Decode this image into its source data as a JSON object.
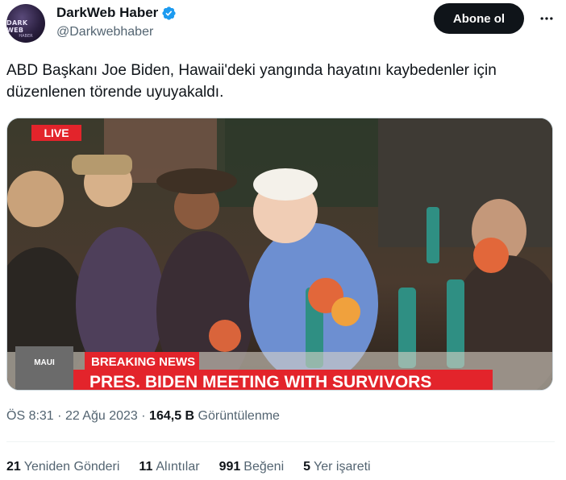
{
  "author": {
    "display_name": "DarkWeb Haber",
    "handle": "@Darkwebhaber",
    "avatar_text_line1": "DARK WEB",
    "avatar_text_line2": "HABER",
    "verified_icon": "verified-badge-icon",
    "verified_color": "#1d9bf0"
  },
  "actions": {
    "follow_label": "Abone ol",
    "more_icon": "more-options-icon"
  },
  "tweet": {
    "text": "ABD Başkanı Joe Biden, Hawaii'deki yangında hayatını kaybedenler için düzenlenen törende uyuyakaldı."
  },
  "media": {
    "live_label": "LIVE",
    "network_label_line1": "MAUI",
    "breaking_label": "BREAKING NEWS",
    "headline": "PRES. BIDEN MEETING WITH SURVIVORS"
  },
  "meta": {
    "time": "ÖS 8:31",
    "separator": "·",
    "date": "22 Ağu 2023",
    "views_count": "164,5 B",
    "views_label": "Görüntülenme"
  },
  "stats": {
    "reposts_count": "21",
    "reposts_label": "Yeniden Gönderi",
    "quotes_count": "11",
    "quotes_label": "Alıntılar",
    "likes_count": "991",
    "likes_label": "Beğeni",
    "bookmarks_count": "5",
    "bookmarks_label": "Yer işareti"
  },
  "colors": {
    "text_primary": "#0f1419",
    "text_secondary": "#536471",
    "breaking_red": "#e3242b"
  }
}
